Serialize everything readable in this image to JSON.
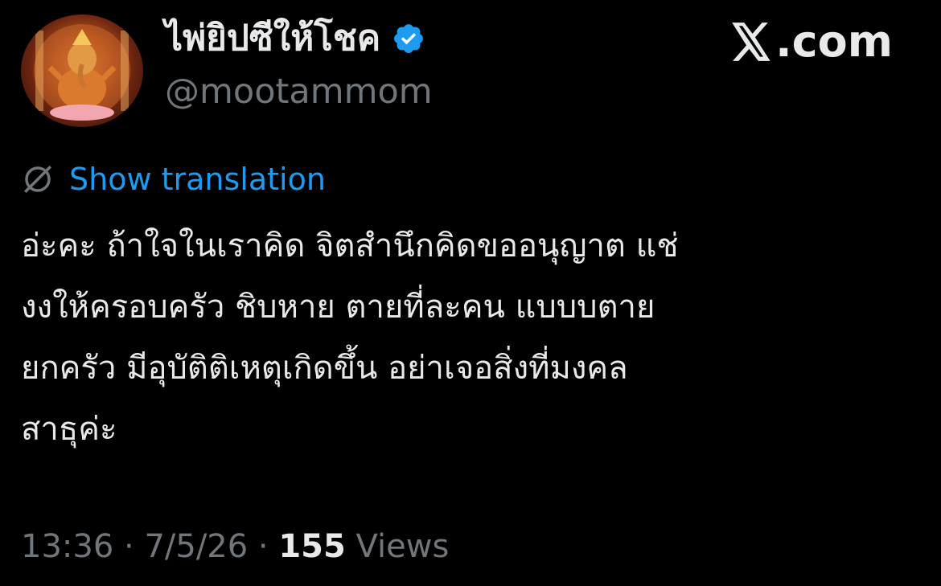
{
  "author": {
    "display_name": "ไพ่ยิปซีให้โชค",
    "handle": "@mootammom",
    "verified_icon": "verified-badge-icon",
    "avatar_icon": "ganesha-avatar"
  },
  "brand": {
    "label": ".com",
    "logo_icon": "x-logo-icon"
  },
  "translation": {
    "icon": "globe-slash-icon",
    "label": "Show translation"
  },
  "tweet": {
    "lines": [
      "อ่ะคะ ถ้าใจในเราคิด จิตสำนึกคิดขออนุญาต แช่",
      "งงให้ครอบครัว ชิบหาย ตายที่ละคน แบบบตาย",
      "ยกครัว มีอุบัติติเหตุเกิดขึ้น อย่าเจอสิ่งที่มงคล",
      "สาธุค่ะ"
    ]
  },
  "meta": {
    "time": "13:36",
    "sep1": " · ",
    "date": "7/5/26",
    "sep2": " · ",
    "views_count": "155",
    "views_label": " Views"
  },
  "colors": {
    "background": "#000000",
    "text": "#e7e9ea",
    "muted": "#71767b",
    "accent": "#1d9bf0"
  }
}
